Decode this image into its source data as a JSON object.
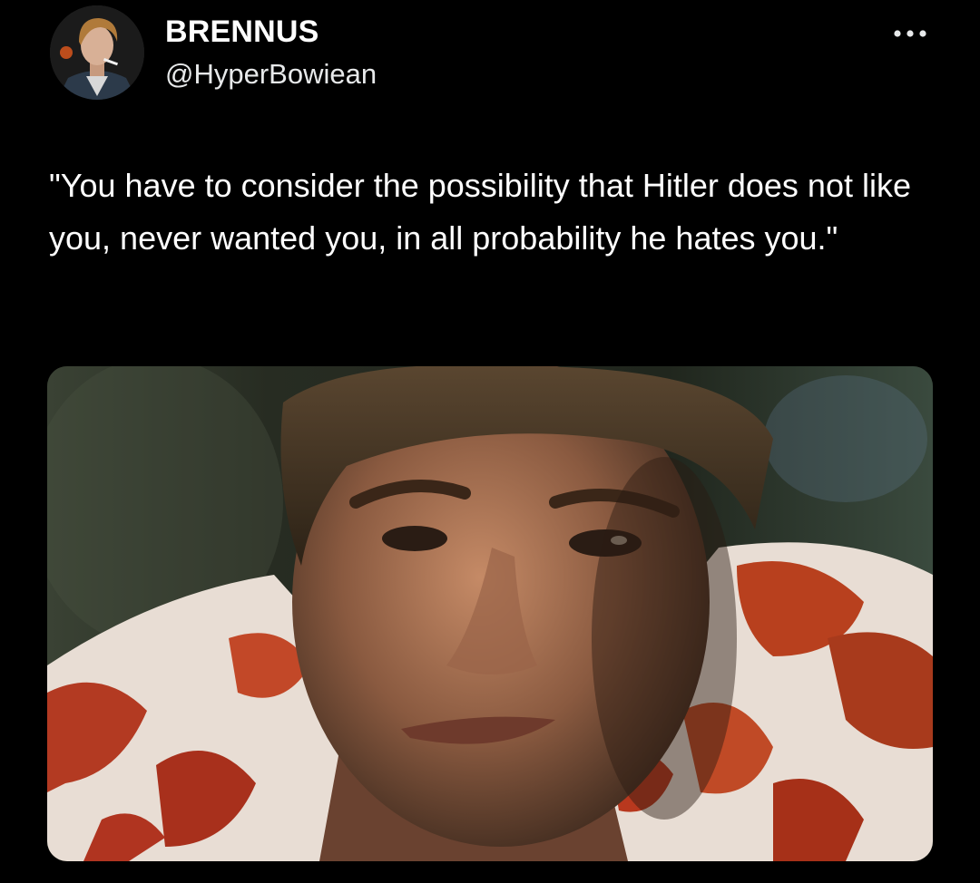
{
  "post": {
    "author": {
      "display_name": "BRENNUS",
      "handle": "@HyperBowiean",
      "avatar_icon": "avatar-portrait"
    },
    "more_icon": "more-dots-icon",
    "text": "\"You have to consider the possibility that Hitler does not like you, never wanted you, in all probability he hates you.\"",
    "media": {
      "kind": "image",
      "subject": "close-up film still of a man in a red and white patterned shirt"
    }
  },
  "colors": {
    "background": "#000000",
    "text_primary": "#ffffff",
    "text_secondary": "#e7e9ea"
  }
}
